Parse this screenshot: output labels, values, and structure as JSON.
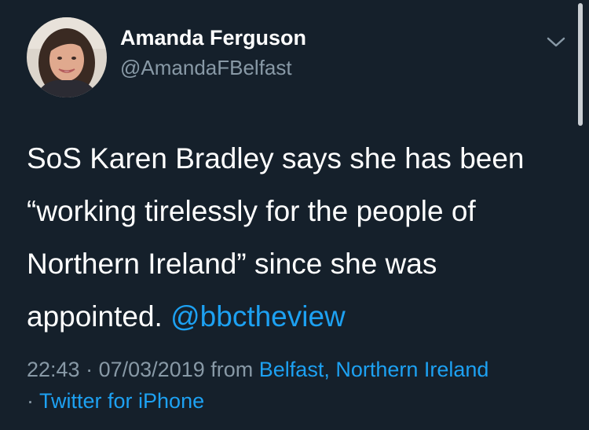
{
  "author": {
    "display_name": "Amanda Ferguson",
    "handle": "@AmandaFBelfast"
  },
  "tweet": {
    "text_line_1": "SoS Karen Bradley says she has been",
    "text_line_2": "“working tirelessly for the people of",
    "text_line_3": "Northern Ireland” since she was",
    "text_line_4": "appointed.",
    "mention": "@bbctheview"
  },
  "meta": {
    "time": "22:43",
    "separator": "·",
    "date": "07/03/2019",
    "from_label": "from",
    "location": "Belfast, Northern Ireland",
    "source": "Twitter for iPhone"
  },
  "icons": {
    "more": "chevron-down-icon",
    "avatar": "profile-photo"
  },
  "colors": {
    "background": "#15202b",
    "text": "#ffffff",
    "secondary": "#8899a6",
    "link": "#1da1f2"
  }
}
